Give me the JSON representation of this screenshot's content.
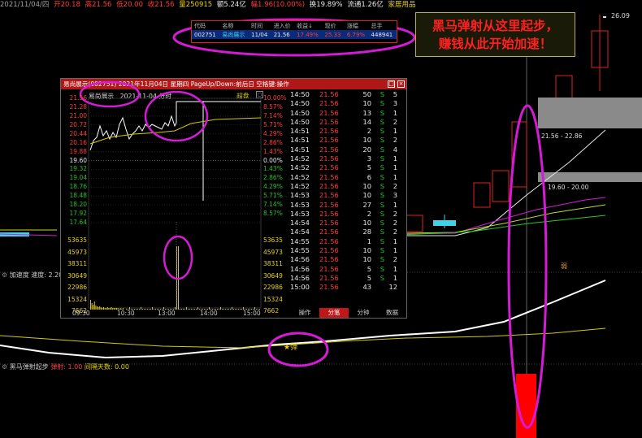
{
  "topbar": {
    "date": "2021/11/04/四",
    "open": "开20.18",
    "high": "高21.56",
    "low": "低20.00",
    "close": "收21.56",
    "volume": "量250915",
    "amount": "额5.24亿",
    "change": "幅1.96(10.00%)",
    "turnover": "换19.89%",
    "float_cap": "流通1.26亿",
    "sector": "家居用品"
  },
  "watchlist": {
    "headers": [
      "代码",
      "名称",
      "时间",
      "进入价",
      "收益↓",
      "现价",
      "涨幅",
      "总手"
    ],
    "row": [
      "002751",
      "易尚展示",
      "11/04",
      "21.56",
      "17.49%",
      "25.33",
      "6.79%",
      "448941"
    ]
  },
  "callout": {
    "line1": "黑马弹射从这里起步，",
    "line2": "赚钱从此开始加速！"
  },
  "main_chart": {
    "price_high_label": "26.09",
    "range1": "21.56 - 22.86",
    "range2": "19.60 - 20.00",
    "marker": "弱"
  },
  "indicator1": {
    "name": "加速度",
    "param": "速度: 2.20"
  },
  "indicator2": {
    "name": "黑马弹射起步",
    "p1": "弹射: 1.00",
    "p2": "间隔天数: 0.00",
    "cross_label": "★弹"
  },
  "popup": {
    "title": "易尚展示(002751) 2021年11月04日 星期四 PageUp/Down:前后日 空格键:操作",
    "header_name": "易尚展示",
    "header_date": "2021-11-04",
    "header_mode": "分时",
    "header_right": "超盘",
    "price_labels": [
      "21.56",
      "21.28",
      "21.00",
      "20.72",
      "20.44",
      "20.16",
      "19.88",
      "19.60",
      "19.32",
      "19.04",
      "18.76",
      "18.48",
      "18.20",
      "17.92",
      "17.64"
    ],
    "pct_labels": [
      "10.00%",
      "8.57%",
      "7.14%",
      "5.71%",
      "4.29%",
      "2.86%",
      "1.43%",
      "0.00%",
      "1.43%",
      "2.86%",
      "4.29%",
      "5.71%",
      "7.14%",
      "8.57%"
    ],
    "vol_labels": [
      "53635",
      "45973",
      "38311",
      "30649",
      "22986",
      "15324",
      "7662"
    ],
    "time_ticks": [
      "09:30",
      "10:30",
      "13:00",
      "14:00",
      "15:00"
    ],
    "trades": [
      [
        "14:50",
        "21.56",
        "50",
        "S",
        "5"
      ],
      [
        "14:50",
        "21.56",
        "10",
        "S",
        "3"
      ],
      [
        "14:50",
        "21.56",
        "13",
        "S",
        "1"
      ],
      [
        "14:50",
        "21.56",
        "14",
        "S",
        "2"
      ],
      [
        "14:51",
        "21.56",
        "2",
        "S",
        "1"
      ],
      [
        "14:51",
        "21.56",
        "10",
        "S",
        "2"
      ],
      [
        "14:51",
        "21.56",
        "20",
        "S",
        "4"
      ],
      [
        "14:52",
        "21.56",
        "3",
        "S",
        "1"
      ],
      [
        "14:52",
        "21.56",
        "5",
        "S",
        "1"
      ],
      [
        "14:52",
        "21.56",
        "6",
        "S",
        "1"
      ],
      [
        "14:52",
        "21.56",
        "10",
        "S",
        "2"
      ],
      [
        "14:53",
        "21.56",
        "10",
        "S",
        "3"
      ],
      [
        "14:53",
        "21.56",
        "27",
        "S",
        "1"
      ],
      [
        "14:53",
        "21.56",
        "2",
        "S",
        "2"
      ],
      [
        "14:54",
        "21.56",
        "10",
        "S",
        "2"
      ],
      [
        "14:54",
        "21.56",
        "28",
        "S",
        "2"
      ],
      [
        "14:55",
        "21.56",
        "1",
        "S",
        "1"
      ],
      [
        "14:55",
        "21.56",
        "10",
        "S",
        "1"
      ],
      [
        "14:56",
        "21.56",
        "10",
        "S",
        "2"
      ],
      [
        "14:56",
        "21.56",
        "5",
        "S",
        "1"
      ],
      [
        "14:56",
        "21.56",
        "5",
        "S",
        "1"
      ],
      [
        "15:00",
        "21.56",
        "43",
        "",
        "12"
      ]
    ],
    "tabs": [
      "操作",
      "分笔",
      "分钟",
      "数据"
    ]
  },
  "colors": {
    "up": "#ff3b3b",
    "down": "#21c321",
    "annotation": "#d61bd6",
    "title_bar": "#b01818"
  }
}
